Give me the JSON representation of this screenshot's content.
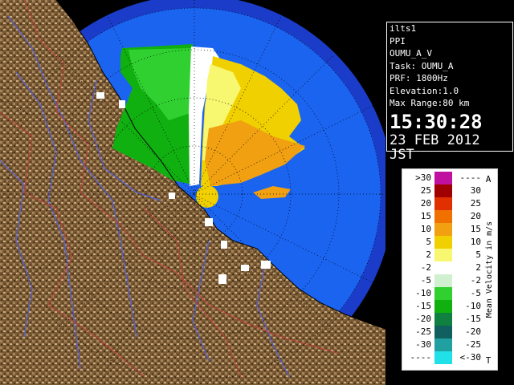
{
  "info": {
    "lines": [
      "ilts1",
      "PPI",
      "OUMU_A_V",
      "Task: OUMU_A",
      "PRF: 1800Hz",
      "Elevation:1.0",
      "Max Range:80 km"
    ],
    "time": "15:30:28",
    "date": "23 FEB 2012 JST"
  },
  "legend": {
    "title": "Mean Velocity in m/s",
    "top_marker": "A",
    "bottom_marker": "T",
    "left": [
      ">30",
      "25",
      "20",
      "15",
      "10",
      "5",
      "2",
      "-2",
      "-5",
      "-10",
      "-15",
      "-20",
      "-25",
      "-30",
      "----"
    ],
    "right": [
      "----",
      "30",
      "25",
      "20",
      "15",
      "10",
      "5",
      "2",
      "-2",
      "-5",
      "-10",
      "-15",
      "-20",
      "-25",
      "<-30"
    ],
    "colors": [
      "#c010a0",
      "#a00000",
      "#e03000",
      "#f07000",
      "#f0a010",
      "#f0d000",
      "#f8f870",
      "#ffffff",
      "#d0f0d0",
      "#30d030",
      "#10b010",
      "#108040",
      "#106060",
      "#20a0a0",
      "#20e0e8"
    ]
  },
  "colors": {
    "range_ring": "#1a3cc8",
    "field_blue": "#1a64f0",
    "land": "#8a6a40"
  }
}
